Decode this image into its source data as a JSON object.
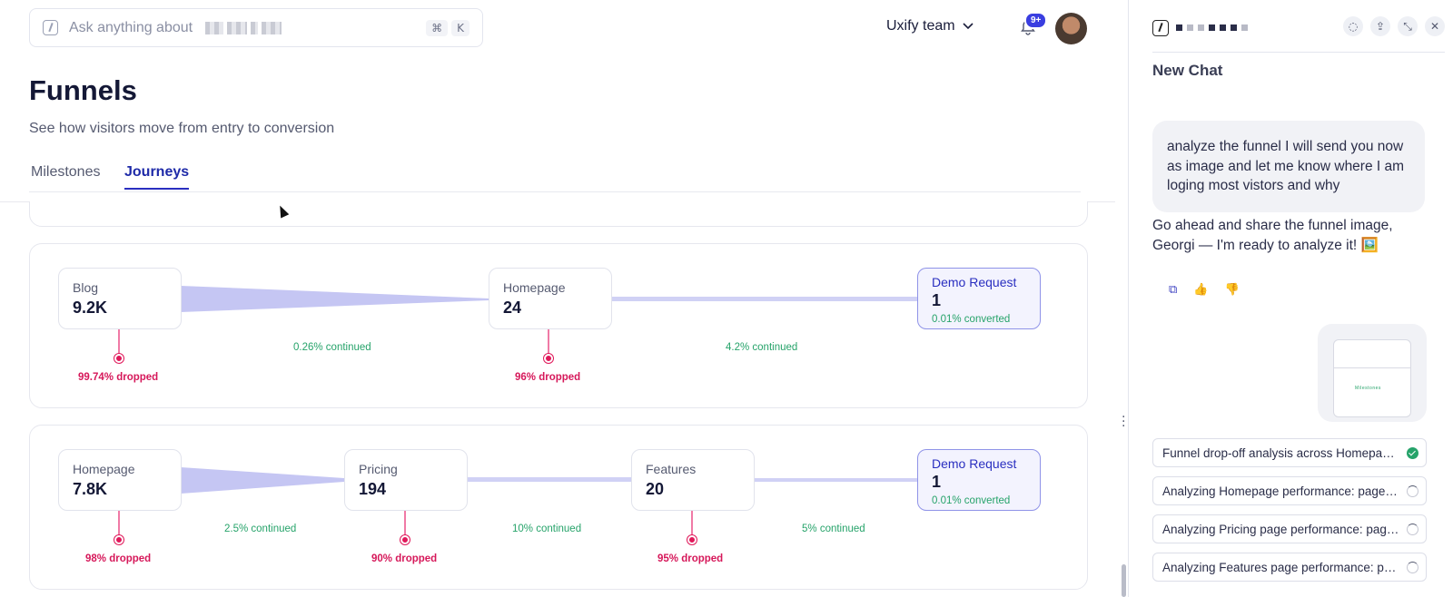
{
  "header": {
    "search_placeholder": "Ask anything about",
    "shortcut_cmd": "⌘",
    "shortcut_key": "K",
    "team": "Uxify team",
    "notifications_badge": "9+"
  },
  "page": {
    "title": "Funnels",
    "subtitle": "See how visitors move from entry to conversion",
    "tabs": [
      "Milestones",
      "Journeys"
    ],
    "active_tab": "Journeys"
  },
  "funnels": [
    {
      "stages": [
        {
          "name": "Blog",
          "value": "9.2K",
          "dropped": "99.74% dropped",
          "continued": "0.26% continued"
        },
        {
          "name": "Homepage",
          "value": "24",
          "dropped": "96% dropped",
          "continued": "4.2% continued"
        },
        {
          "name": "Demo Request",
          "value": "1",
          "converted": "0.01% converted"
        }
      ]
    },
    {
      "stages": [
        {
          "name": "Homepage",
          "value": "7.8K",
          "dropped": "98% dropped",
          "continued": "2.5% continued"
        },
        {
          "name": "Pricing",
          "value": "194",
          "dropped": "90% dropped",
          "continued": "10% continued"
        },
        {
          "name": "Features",
          "value": "20",
          "dropped": "95% dropped",
          "continued": "5% continued"
        },
        {
          "name": "Demo Request",
          "value": "1",
          "converted": "0.01% converted"
        }
      ]
    }
  ],
  "chat": {
    "title": "New Chat",
    "user_message": "analyze the funnel I will send you now as image and let me know where I am loging most vistors and why",
    "assistant_reply": "Go ahead and share the funnel image, Georgi — I'm ready to analyze it! 🖼️",
    "attachment_caption": "Milestones",
    "tasks": [
      {
        "label": "Funnel drop-off analysis across Homepage, Pricing, Features",
        "status": "done"
      },
      {
        "label": "Analyzing Homepage performance: page speed and engagement",
        "status": "running"
      },
      {
        "label": "Analyzing Pricing page performance: page speed and engagement",
        "status": "running"
      },
      {
        "label": "Analyzing Features page performance: page speed",
        "status": "running"
      }
    ]
  },
  "colors": {
    "accent": "#2a2fc0",
    "continued": "#26a36a",
    "dropped": "#d6185a",
    "flow": "#b9bbf0"
  }
}
